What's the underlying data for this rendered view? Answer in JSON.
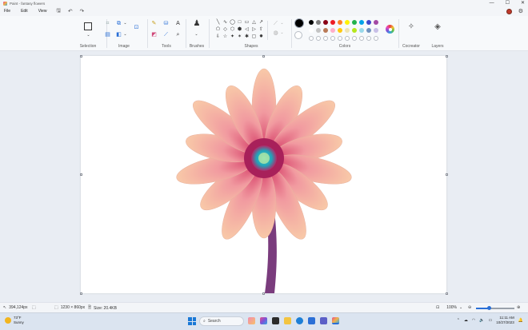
{
  "window": {
    "title": "Paint - fantasy flowers",
    "controls": [
      "—",
      "☐",
      "✕"
    ]
  },
  "menu": {
    "items": [
      "File",
      "Edit",
      "View"
    ],
    "undo": "↶",
    "redo": "↷",
    "save": "🖫"
  },
  "ribbon": {
    "groups": {
      "selection": "Selection",
      "image": "Image",
      "tools": "Tools",
      "brushes": "Brushes",
      "shapes": "Shapes",
      "colors": "Colors",
      "cocreator": "Cocreator",
      "layers": "Layers"
    },
    "shapes_row1": [
      "╲",
      "∿",
      "◯",
      "□",
      "▭",
      "△",
      "↗"
    ],
    "shapes_row2": [
      "⬠",
      "◇",
      "⬡",
      "⬢",
      "◁",
      "▷",
      "⇧"
    ],
    "shapes_row3": [
      "⇩",
      "☆",
      "✦",
      "✶",
      "✱",
      "▢",
      "✸"
    ],
    "colors": {
      "primary": "#000000",
      "secondary": "#ffffff",
      "row1": [
        "#000000",
        "#7f7f7f",
        "#880015",
        "#ed1c24",
        "#ff7f27",
        "#fff200",
        "#22b14c",
        "#00a2e8",
        "#3f48cc",
        "#a349a4"
      ],
      "row2": [
        "#ffffff",
        "#c3c3c3",
        "#b97a57",
        "#ffaec9",
        "#ffc90e",
        "#efe4b0",
        "#b5e61d",
        "#99d9ea",
        "#7092be",
        "#c8bfe7"
      ]
    }
  },
  "status": {
    "cursor": "394,124px",
    "image_size": "1230 × 860px",
    "file_size": "Size: 20.4KB",
    "zoom": "100%",
    "zoom_fraction": 0.35
  },
  "taskbar": {
    "temp": "73°F",
    "condition": "Sunny",
    "search_placeholder": "Search",
    "time": "11:11 AM",
    "date": "10/27/2023"
  }
}
